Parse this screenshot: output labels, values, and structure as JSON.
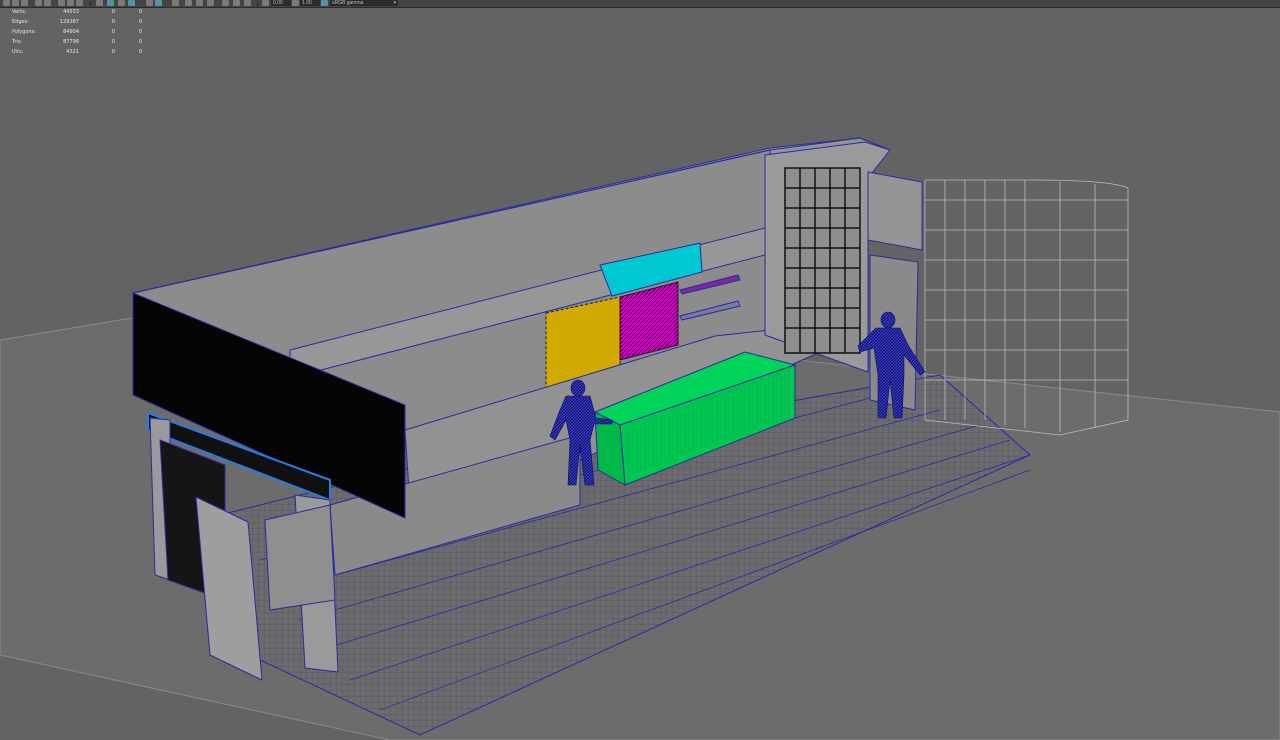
{
  "toolbar": {
    "exposure_value": "0.00",
    "gamma_value": "1.00",
    "color_space": "sRGB gamma"
  },
  "hud": {
    "rows": [
      {
        "label": "Verts:",
        "values": [
          "44933",
          "0",
          "0"
        ]
      },
      {
        "label": "Edges:",
        "values": [
          "129367",
          "0",
          "0"
        ]
      },
      {
        "label": "Polygons:",
        "values": [
          "84904",
          "0",
          "0"
        ]
      },
      {
        "label": "Tris:",
        "values": [
          "87796",
          "0",
          "0"
        ]
      },
      {
        "label": "UVs:",
        "values": [
          "4321",
          "0",
          "0"
        ]
      }
    ]
  },
  "colors": {
    "background": "#636363",
    "wall": "#8f8f8f",
    "wireframe": "#2a2aa0",
    "accent_yellow": "#d2a900",
    "accent_magenta": "#d600c8",
    "accent_cyan": "#00c8d2",
    "accent_green": "#00c84e",
    "figure": "#1a1a90"
  },
  "icons": [
    "select-icon",
    "lasso-icon",
    "paint-icon",
    "move-icon",
    "rotate-icon",
    "scale-icon",
    "camera-icon",
    "grid-icon",
    "wireframe-icon",
    "shaded-icon",
    "texture-icon",
    "light-icon",
    "shadow-icon",
    "xray-icon",
    "isolate-icon",
    "exposure-icon",
    "gamma-icon",
    "colorspace-icon"
  ]
}
